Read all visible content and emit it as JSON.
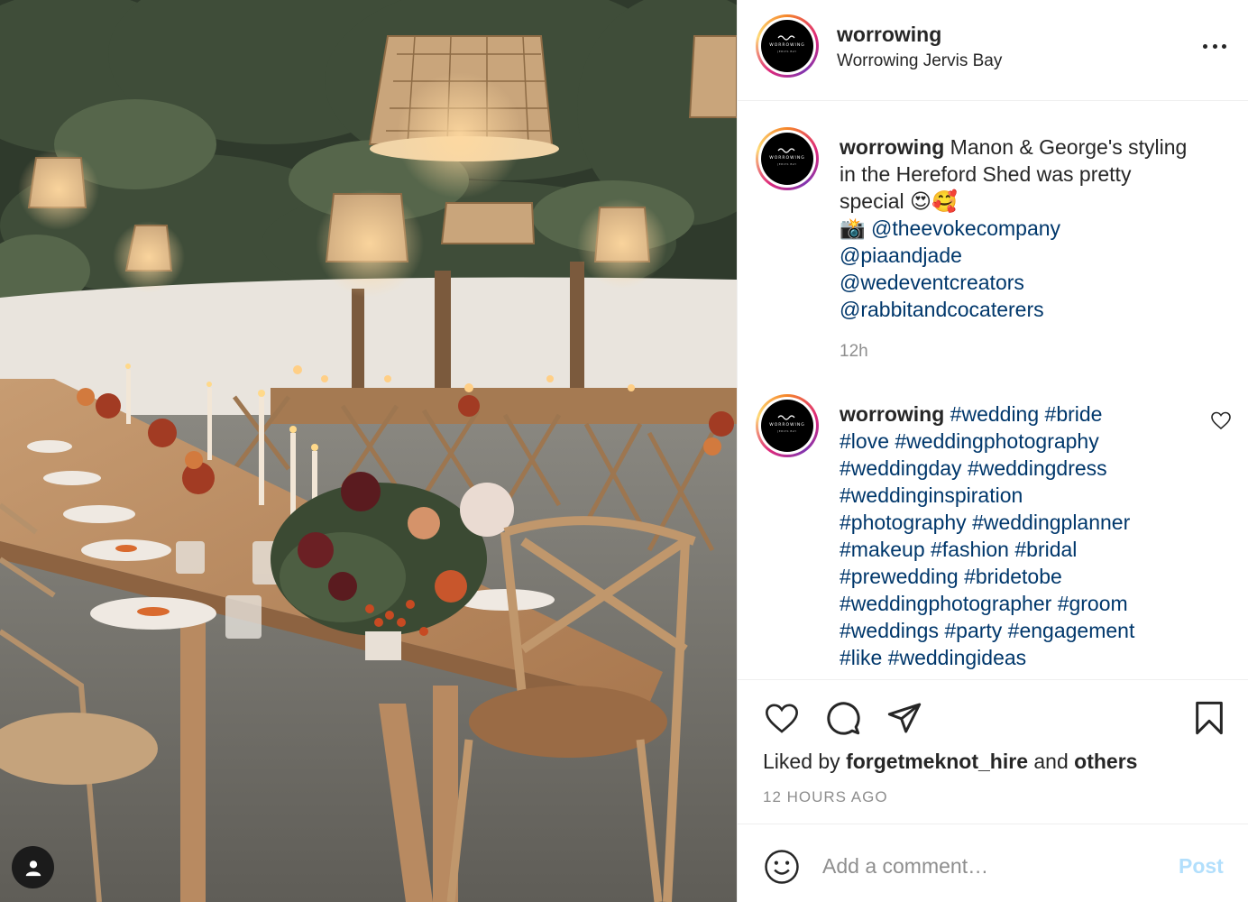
{
  "photo": {
    "alt_subject": "wedding reception table setting",
    "icon": "user-tag-icon"
  },
  "post": {
    "username": "worrowing",
    "location": "Worrowing Jervis Bay",
    "logo_text": "WORROWING",
    "logo_sub": "JERVIS BAY",
    "more_icon": "more-options-icon"
  },
  "caption": {
    "username": "worrowing",
    "lines": [
      "Manon & George's styling",
      "in the Hereford Shed was pretty",
      "special 😍🥰"
    ],
    "camera_emoji": "📸",
    "mentions": [
      "@theevokecompany",
      "@piaandjade",
      "@wedeventcreators",
      "@rabbitandcocaterers"
    ],
    "time": "12h"
  },
  "hashtag_comment": {
    "username": "worrowing",
    "first_line": "#wedding #bride",
    "lines": [
      "#love #weddingphotography",
      "#weddingday #weddingdress",
      "#weddinginspiration",
      "#photography #weddingplanner",
      "#makeup #fashion #bridal",
      "#prewedding #bridetobe",
      "#weddingphotographer #groom",
      "#weddings #party #engagement",
      "#like #weddingideas"
    ],
    "like_icon": "heart-outline-icon"
  },
  "actions": {
    "icons": [
      "heart-icon",
      "comment-icon",
      "share-icon",
      "bookmark-icon"
    ],
    "liked_by_prefix": "Liked by",
    "liked_by_user": "forgetmeknot_hire",
    "liked_by_and": "and",
    "liked_by_others": "others",
    "time_ago": "12 HOURS AGO"
  },
  "add_comment": {
    "placeholder": "Add a comment…",
    "post_label": "Post",
    "emoji_icon": "emoji-icon"
  },
  "colors": {
    "link": "#00376b",
    "muted": "#8e8e8e",
    "post_disabled": "#b2dffc",
    "text": "#262626"
  }
}
